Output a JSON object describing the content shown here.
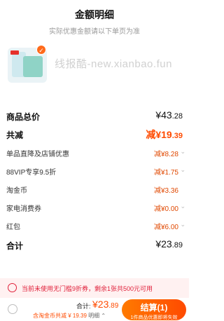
{
  "header": {
    "title": "金额明细",
    "subtitle": "实际优惠金额请以下单页为准",
    "close_label": "×"
  },
  "product": {
    "checked_mark": "✓",
    "watermark": "线报酷-new.xianbao.fun"
  },
  "summary": {
    "total_label": "商品总价",
    "total_symbol": "¥",
    "total_int": "43",
    "total_dec": ".28",
    "discount_label": "共减",
    "discount_prefix": "减¥",
    "discount_int": "19",
    "discount_dec": ".39",
    "items": [
      {
        "label": "单品直降及店铺优惠",
        "value_int": "减¥8",
        "value_dec": ".28",
        "has_chevron": true
      },
      {
        "label": "88VIP专享9.5折",
        "value_int": "减¥1",
        "value_dec": ".75",
        "has_chevron": true
      },
      {
        "label": "淘金币",
        "value_int": "减¥3",
        "value_dec": ".36",
        "has_chevron": false
      },
      {
        "label": "家电消费券",
        "value_int": "减¥0",
        "value_dec": ".00",
        "has_chevron": true
      },
      {
        "label": "红包",
        "value_int": "减¥6",
        "value_dec": ".00",
        "has_chevron": true
      }
    ],
    "sum_label": "合计",
    "sum_symbol": "¥",
    "sum_int": "23",
    "sum_dec": ".89"
  },
  "notice": {
    "text": "当前未使用无门槛9折券，剩余1张共500元可用"
  },
  "footer": {
    "total_label": "合计:",
    "total_symbol": "¥",
    "total_int": "23",
    "total_dec": ".89",
    "sub_text": "含淘金币共减 ¥ 19.39",
    "detail_text": "明细",
    "pay_label": "结算(1)",
    "pay_hint": "1件商品优惠即将失效"
  },
  "colors": {
    "accent": "#ff4b00",
    "notice_red": "#e0203a",
    "notice_bg": "#fff1f1"
  }
}
